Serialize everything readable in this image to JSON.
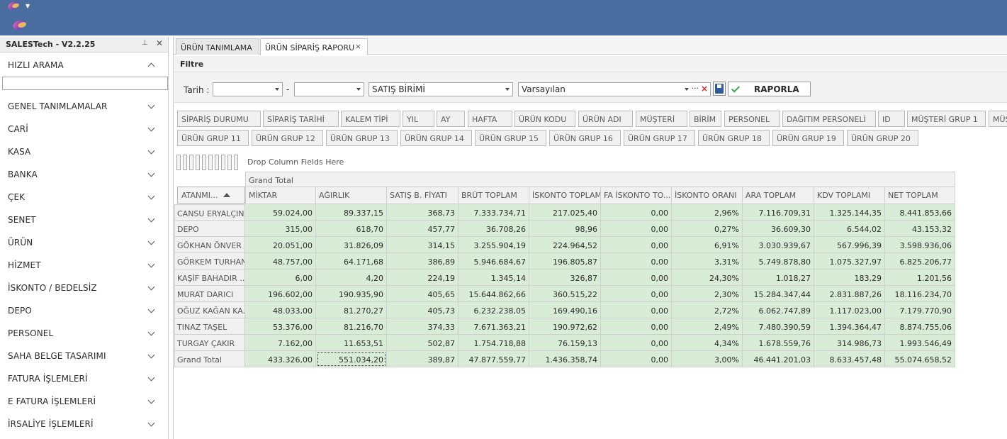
{
  "sidebar": {
    "title": "SALESTech - V2.2.25",
    "items": [
      {
        "label": "HIZLI ARAMA",
        "expanded": true
      },
      {
        "label": "GENEL TANIMLAMALAR"
      },
      {
        "label": "CARİ"
      },
      {
        "label": "KASA"
      },
      {
        "label": "BANKA"
      },
      {
        "label": "ÇEK"
      },
      {
        "label": "SENET"
      },
      {
        "label": "ÜRÜN"
      },
      {
        "label": "HİZMET"
      },
      {
        "label": "İSKONTO / BEDELSİZ"
      },
      {
        "label": "DEPO"
      },
      {
        "label": "PERSONEL"
      },
      {
        "label": "SAHA BELGE TASARIMI"
      },
      {
        "label": "FATURA İŞLEMLERİ"
      },
      {
        "label": "E FATURA İŞLEMLERİ"
      },
      {
        "label": "İRSALİYE İŞLEMLERİ"
      }
    ],
    "search_value": ""
  },
  "tabs": [
    {
      "label": "ÜRÜN TANIMLAMA"
    },
    {
      "label": "ÜRÜN SİPARİŞ RAPORU",
      "close": "×"
    }
  ],
  "filter": {
    "title": "Filtre",
    "date_label": "Tarih :",
    "date_from": "",
    "date_sep": "-",
    "date_to": "",
    "unit_value": "SATIŞ BİRİMİ",
    "layout_value": "Varsayılan",
    "ellipsis": "···",
    "clear": "×",
    "report_button": "RAPORLA"
  },
  "field_chips_row1": [
    "SİPARİŞ DURUMU",
    "SİPARİŞ TARİHİ",
    "KALEM TİPİ",
    "YIL",
    "AY",
    "HAFTA",
    "ÜRÜN KODU",
    "ÜRÜN ADI",
    "MÜŞTERİ",
    "BİRİM",
    "PERSONEL",
    "DAĞITIM PERSONELİ",
    "ID",
    "MÜŞTERİ GRUP 1",
    "MÜŞ"
  ],
  "field_chips_row2": [
    "ÜRÜN GRUP 11",
    "ÜRÜN GRUP 12",
    "ÜRÜN GRUP 13",
    "ÜRÜN GRUP 14",
    "ÜRÜN GRUP 15",
    "ÜRÜN GRUP 16",
    "ÜRÜN GRUP 17",
    "ÜRÜN GRUP 18",
    "ÜRÜN GRUP 19",
    "ÜRÜN GRUP 20"
  ],
  "drop_hint": "Drop Column Fields Here",
  "pivot": {
    "grand_total_header": "Grand Total",
    "row_field": "ATANMI...",
    "columns": [
      "MİKTAR",
      "AĞIRLIK",
      "SATIŞ B. FİYATI",
      "BRÜT TOPLAM",
      "İSKONTO TOPLAMI",
      "FA İSKONTO TO...",
      "İSKONTO ORANI",
      "ARA TOPLAM",
      "KDV TOPLAMI",
      "NET TOPLAM"
    ],
    "rows": [
      {
        "name": "CANSU ERYALÇIN",
        "values": [
          "59.024,00",
          "89.337,15",
          "368,73",
          "7.333.734,71",
          "217.025,40",
          "0,00",
          "2,96%",
          "7.116.709,31",
          "1.325.144,35",
          "8.441.853,66"
        ]
      },
      {
        "name": "DEPO",
        "values": [
          "315,00",
          "618,70",
          "457,77",
          "36.708,26",
          "98,96",
          "0,00",
          "0,27%",
          "36.609,30",
          "6.544,02",
          "43.153,32"
        ]
      },
      {
        "name": "GÖKHAN ÖNVER",
        "values": [
          "20.051,00",
          "31.826,09",
          "314,15",
          "3.255.904,19",
          "224.964,52",
          "0,00",
          "6,91%",
          "3.030.939,67",
          "567.996,39",
          "3.598.936,06"
        ]
      },
      {
        "name": "GÖRKEM TURHAN",
        "values": [
          "48.757,00",
          "64.171,68",
          "386,89",
          "5.946.684,67",
          "196.805,87",
          "0,00",
          "3,31%",
          "5.749.878,80",
          "1.075.327,97",
          "6.825.206,77"
        ]
      },
      {
        "name": "KAŞİF BAHADIR ...",
        "values": [
          "6,00",
          "4,20",
          "224,19",
          "1.345,14",
          "326,87",
          "0,00",
          "24,30%",
          "1.018,27",
          "183,29",
          "1.201,56"
        ]
      },
      {
        "name": "MURAT DARICI",
        "values": [
          "196.602,00",
          "190.935,90",
          "405,65",
          "15.644.862,66",
          "360.515,22",
          "0,00",
          "2,30%",
          "15.284.347,44",
          "2.831.887,26",
          "18.116.234,70"
        ]
      },
      {
        "name": "OĞUZ KAĞAN KA...",
        "values": [
          "48.033,00",
          "81.270,27",
          "405,73",
          "6.232.238,05",
          "169.490,16",
          "0,00",
          "2,72%",
          "6.062.747,89",
          "1.117.023,00",
          "7.179.770,90"
        ]
      },
      {
        "name": "TINAZ TAŞEL",
        "values": [
          "53.376,00",
          "81.216,70",
          "374,33",
          "7.671.363,21",
          "190.972,62",
          "0,00",
          "2,49%",
          "7.480.390,59",
          "1.394.364,47",
          "8.874.755,06"
        ]
      },
      {
        "name": "TURGAY ÇAKIR",
        "values": [
          "7.162,00",
          "11.653,51",
          "502,87",
          "1.754.718,88",
          "76.159,13",
          "0,00",
          "4,34%",
          "1.678.559,76",
          "314.986,73",
          "1.993.546,49"
        ]
      }
    ],
    "total_label": "Grand Total",
    "totals": [
      "433.326,00",
      "551.034,20",
      "389,87",
      "47.877.559,77",
      "1.436.358,74",
      "0,00",
      "3,00%",
      "46.441.201,03",
      "8.633.457,48",
      "55.074.658,52"
    ]
  }
}
